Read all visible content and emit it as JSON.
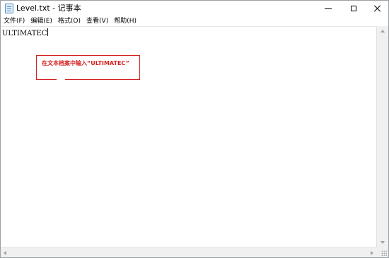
{
  "window": {
    "title": "Level.txt - 记事本",
    "icon": "notepad-icon"
  },
  "menu": {
    "items": [
      {
        "label": "文件(F)"
      },
      {
        "label": "编辑(E)"
      },
      {
        "label": "格式(O)"
      },
      {
        "label": "查看(V)"
      },
      {
        "label": "帮助(H)"
      }
    ]
  },
  "editor": {
    "content": "ULTIMATEC"
  },
  "annotation": {
    "text": "在文本档案中输入“ULTIMATEC”",
    "color": "#d61f1f"
  }
}
